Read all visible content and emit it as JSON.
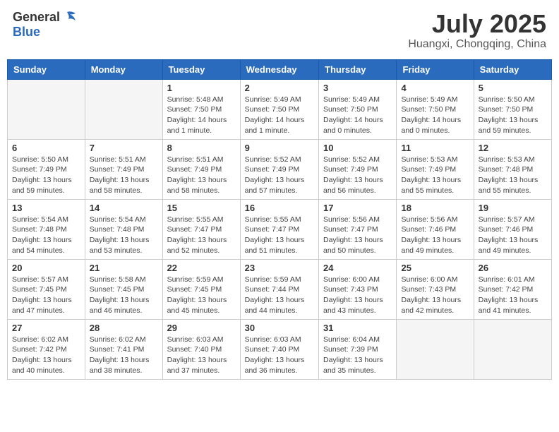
{
  "header": {
    "logo_general": "General",
    "logo_blue": "Blue",
    "title": "July 2025",
    "location": "Huangxi, Chongqing, China"
  },
  "weekdays": [
    "Sunday",
    "Monday",
    "Tuesday",
    "Wednesday",
    "Thursday",
    "Friday",
    "Saturday"
  ],
  "weeks": [
    [
      {
        "day": "",
        "empty": true
      },
      {
        "day": "",
        "empty": true
      },
      {
        "day": "1",
        "info": "Sunrise: 5:48 AM\nSunset: 7:50 PM\nDaylight: 14 hours\nand 1 minute."
      },
      {
        "day": "2",
        "info": "Sunrise: 5:49 AM\nSunset: 7:50 PM\nDaylight: 14 hours\nand 1 minute."
      },
      {
        "day": "3",
        "info": "Sunrise: 5:49 AM\nSunset: 7:50 PM\nDaylight: 14 hours\nand 0 minutes."
      },
      {
        "day": "4",
        "info": "Sunrise: 5:49 AM\nSunset: 7:50 PM\nDaylight: 14 hours\nand 0 minutes."
      },
      {
        "day": "5",
        "info": "Sunrise: 5:50 AM\nSunset: 7:50 PM\nDaylight: 13 hours\nand 59 minutes."
      }
    ],
    [
      {
        "day": "6",
        "info": "Sunrise: 5:50 AM\nSunset: 7:49 PM\nDaylight: 13 hours\nand 59 minutes."
      },
      {
        "day": "7",
        "info": "Sunrise: 5:51 AM\nSunset: 7:49 PM\nDaylight: 13 hours\nand 58 minutes."
      },
      {
        "day": "8",
        "info": "Sunrise: 5:51 AM\nSunset: 7:49 PM\nDaylight: 13 hours\nand 58 minutes."
      },
      {
        "day": "9",
        "info": "Sunrise: 5:52 AM\nSunset: 7:49 PM\nDaylight: 13 hours\nand 57 minutes."
      },
      {
        "day": "10",
        "info": "Sunrise: 5:52 AM\nSunset: 7:49 PM\nDaylight: 13 hours\nand 56 minutes."
      },
      {
        "day": "11",
        "info": "Sunrise: 5:53 AM\nSunset: 7:49 PM\nDaylight: 13 hours\nand 55 minutes."
      },
      {
        "day": "12",
        "info": "Sunrise: 5:53 AM\nSunset: 7:48 PM\nDaylight: 13 hours\nand 55 minutes."
      }
    ],
    [
      {
        "day": "13",
        "info": "Sunrise: 5:54 AM\nSunset: 7:48 PM\nDaylight: 13 hours\nand 54 minutes."
      },
      {
        "day": "14",
        "info": "Sunrise: 5:54 AM\nSunset: 7:48 PM\nDaylight: 13 hours\nand 53 minutes."
      },
      {
        "day": "15",
        "info": "Sunrise: 5:55 AM\nSunset: 7:47 PM\nDaylight: 13 hours\nand 52 minutes."
      },
      {
        "day": "16",
        "info": "Sunrise: 5:55 AM\nSunset: 7:47 PM\nDaylight: 13 hours\nand 51 minutes."
      },
      {
        "day": "17",
        "info": "Sunrise: 5:56 AM\nSunset: 7:47 PM\nDaylight: 13 hours\nand 50 minutes."
      },
      {
        "day": "18",
        "info": "Sunrise: 5:56 AM\nSunset: 7:46 PM\nDaylight: 13 hours\nand 49 minutes."
      },
      {
        "day": "19",
        "info": "Sunrise: 5:57 AM\nSunset: 7:46 PM\nDaylight: 13 hours\nand 49 minutes."
      }
    ],
    [
      {
        "day": "20",
        "info": "Sunrise: 5:57 AM\nSunset: 7:45 PM\nDaylight: 13 hours\nand 47 minutes."
      },
      {
        "day": "21",
        "info": "Sunrise: 5:58 AM\nSunset: 7:45 PM\nDaylight: 13 hours\nand 46 minutes."
      },
      {
        "day": "22",
        "info": "Sunrise: 5:59 AM\nSunset: 7:45 PM\nDaylight: 13 hours\nand 45 minutes."
      },
      {
        "day": "23",
        "info": "Sunrise: 5:59 AM\nSunset: 7:44 PM\nDaylight: 13 hours\nand 44 minutes."
      },
      {
        "day": "24",
        "info": "Sunrise: 6:00 AM\nSunset: 7:43 PM\nDaylight: 13 hours\nand 43 minutes."
      },
      {
        "day": "25",
        "info": "Sunrise: 6:00 AM\nSunset: 7:43 PM\nDaylight: 13 hours\nand 42 minutes."
      },
      {
        "day": "26",
        "info": "Sunrise: 6:01 AM\nSunset: 7:42 PM\nDaylight: 13 hours\nand 41 minutes."
      }
    ],
    [
      {
        "day": "27",
        "info": "Sunrise: 6:02 AM\nSunset: 7:42 PM\nDaylight: 13 hours\nand 40 minutes."
      },
      {
        "day": "28",
        "info": "Sunrise: 6:02 AM\nSunset: 7:41 PM\nDaylight: 13 hours\nand 38 minutes."
      },
      {
        "day": "29",
        "info": "Sunrise: 6:03 AM\nSunset: 7:40 PM\nDaylight: 13 hours\nand 37 minutes."
      },
      {
        "day": "30",
        "info": "Sunrise: 6:03 AM\nSunset: 7:40 PM\nDaylight: 13 hours\nand 36 minutes."
      },
      {
        "day": "31",
        "info": "Sunrise: 6:04 AM\nSunset: 7:39 PM\nDaylight: 13 hours\nand 35 minutes."
      },
      {
        "day": "",
        "empty": true
      },
      {
        "day": "",
        "empty": true
      }
    ]
  ]
}
